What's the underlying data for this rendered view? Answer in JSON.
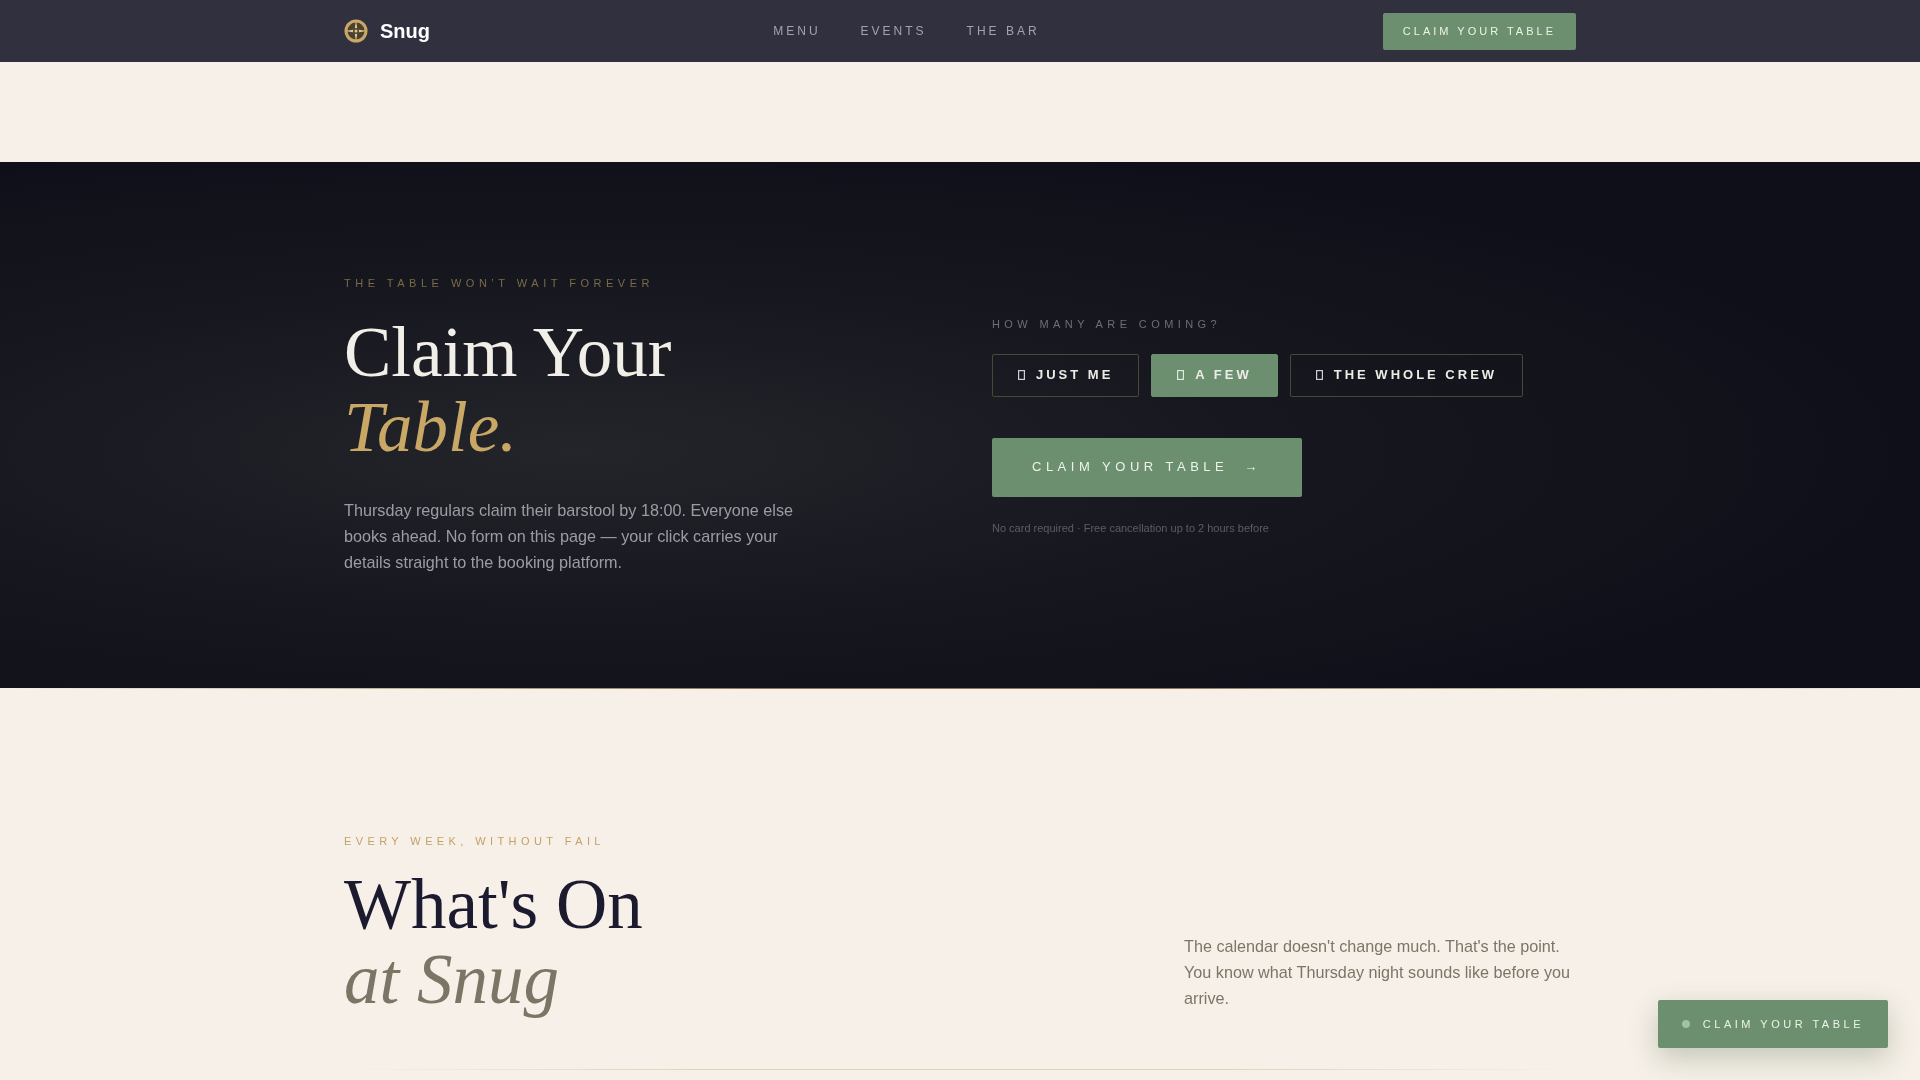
{
  "navbar": {
    "brand": "Snug",
    "links": [
      {
        "label": "MENU"
      },
      {
        "label": "EVENTS"
      },
      {
        "label": "THE BAR"
      }
    ],
    "cta": "CLAIM YOUR TABLE"
  },
  "hero": {
    "eyebrow": "THE TABLE WON’T WAIT FOREVER",
    "title": "Claim Your",
    "title_accent": "Table.",
    "text": "Thursday regulars claim their barstool by 18:00. Everyone else books ahead. No form on this page — your click carries your details straight to the booking platform.",
    "party": {
      "label": "HOW MANY ARE COMING?",
      "options": [
        {
          "label": "JUST ME",
          "selected": false
        },
        {
          "label": "A FEW",
          "selected": true
        },
        {
          "label": "THE WHOLE CREW",
          "selected": false
        }
      ]
    },
    "cta": {
      "label": "CLAIM YOUR TABLE",
      "arrow": "→"
    },
    "note": "No card required · Free cancellation up to 2 hours before"
  },
  "whats_on": {
    "eyebrow": "EVERY WEEK, WITHOUT FAIL",
    "title": "What's On",
    "title_accent": "at Snug",
    "text": "The calendar doesn't change much. That's the point. You know what Thursday night sounds like before you arrive."
  },
  "floating_cta": {
    "label": "CLAIM YOUR TABLE"
  }
}
